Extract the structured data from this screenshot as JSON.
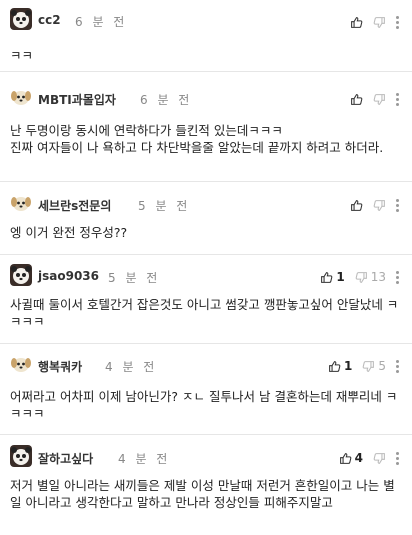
{
  "comments": [
    {
      "nick": "cc2",
      "time": "6 분 전",
      "body": "ㅋㅋ",
      "avatar": "panda-avatar",
      "up": "",
      "down": ""
    },
    {
      "nick": "MBTI과몰입자",
      "time": "6 분 전",
      "body": "난 두명이랑 동시에 연락하다가 들킨적 있는데ㅋㅋㅋ\n진짜 여자들이 나 욕하고 다 차단박을줄 알았는데 끝까지 하려고 하더라.",
      "avatar": "puppy-avatar",
      "up": "",
      "down": ""
    },
    {
      "nick": "세브란s전문의",
      "time": "5 분 전",
      "body": "엥 이거 완전 정우성??",
      "avatar": "puppy-avatar",
      "up": "",
      "down": ""
    },
    {
      "nick": "jsao9036",
      "time": "5 분 전",
      "body": "사귈때 둘이서 호텔간거 잡은것도 아니고 썸갖고 깽판놓고싶어 안달났네 ㅋㅋㅋㅋ",
      "avatar": "panda-avatar",
      "up": "1",
      "down": "13"
    },
    {
      "nick": "행복쿼카",
      "time": "4 분 전",
      "body": "어쩌라고 어차피 이제 남아닌가? ㅈㄴ 질투나서 남 결혼하는데 재뿌리네 ㅋㅋㅋㅋ",
      "avatar": "puppy-avatar",
      "up": "1",
      "down": "5"
    },
    {
      "nick": "잘하고싶다",
      "time": "4 분 전",
      "body": "저거 별일 아니라는 새끼들은 제발 이성 만날때 저런거 흔한일이고 나는 별일 아니라고 생각한다고 말하고 만나라 정상인들 피해주지말고",
      "avatar": "panda-avatar",
      "up": "4",
      "down": ""
    }
  ]
}
